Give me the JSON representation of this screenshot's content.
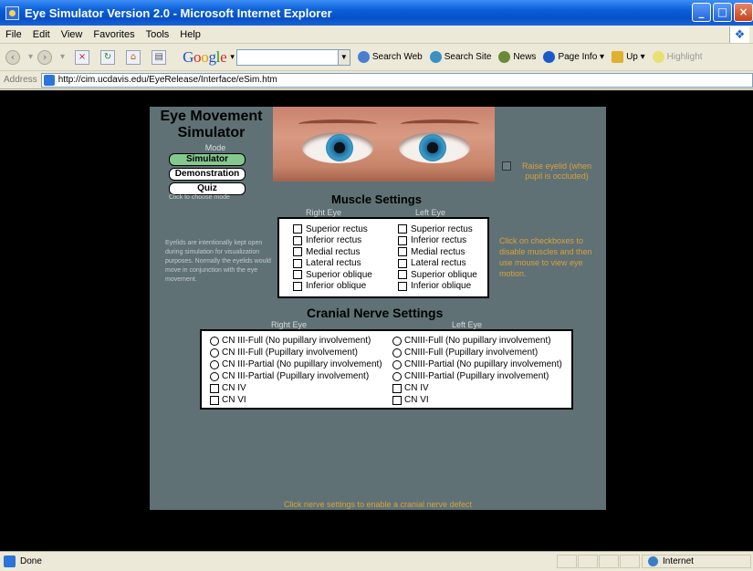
{
  "window": {
    "title": "Eye Simulator Version 2.0 - Microsoft Internet Explorer"
  },
  "menu": [
    "File",
    "Edit",
    "View",
    "Favorites",
    "Tools",
    "Help"
  ],
  "toolbar": {
    "google": [
      "G",
      "o",
      "o",
      "g",
      "l",
      "e"
    ],
    "buttons": [
      "Search Web",
      "Search Site",
      "News",
      "Page Info ▾",
      "Up ▾",
      "Highlight"
    ]
  },
  "address": {
    "label": "Address",
    "url": "http://cim.ucdavis.edu/EyeRelease/Interface/eSim.htm"
  },
  "sim": {
    "title_line1": "Eye Movement",
    "title_line2": "Simulator",
    "mode_label": "Mode",
    "modes": [
      "Simulator",
      "Demonstration",
      "Quiz"
    ],
    "click_hint": "Click to choose mode",
    "raise_eyelid": "Raise eyelid (when pupil is occluded)",
    "muscle_heading": "Muscle Settings",
    "right_eye": "Right Eye",
    "left_eye": "Left Eye",
    "muscles": [
      "Superior rectus",
      "Inferior rectus",
      "Medial rectus",
      "Lateral rectus",
      "Superior oblique",
      "Inferior oblique"
    ],
    "eyelid_note": "Eyelids are intentionally kept open during simulation for visualization purposes. Normally the eyelids would move in conjunction with the eye movement.",
    "muscle_hint": "Click on checkboxes to disable muscles and then use mouse to view eye motion.",
    "nerve_heading": "Cranial Nerve Settings",
    "nerves_right": {
      "radios": [
        "CN III-Full (No pupillary involvement)",
        "CN III-Full (Pupillary involvement)",
        "CN III-Partial (No pupillary involvement)",
        "CN III-Partial (Pupillary involvement)"
      ],
      "checks": [
        "CN IV",
        "CN VI"
      ]
    },
    "nerves_left": {
      "radios": [
        "CNIII-Full (No pupillary involvement)",
        "CNIII-Full (Pupillary involvement)",
        "CNIII-Partial (No pupillary involvement)",
        "CNIII-Partial (Pupillary involvement)"
      ],
      "checks": [
        "CN IV",
        "CN VI"
      ]
    },
    "nerve_hint": "Click nerve settings to enable a cranial nerve defect"
  },
  "status": {
    "text": "Done",
    "zone": "Internet"
  }
}
